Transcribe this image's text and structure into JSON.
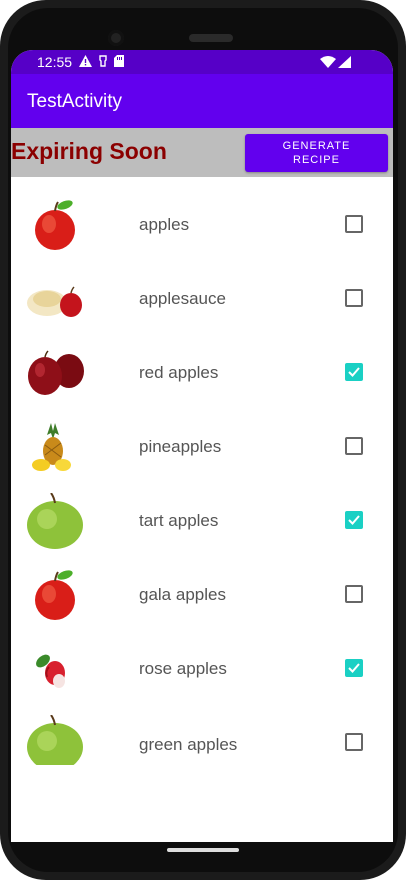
{
  "status_bar": {
    "time": "12:55"
  },
  "app_bar": {
    "title": "TestActivity"
  },
  "header": {
    "title": "Expiring Soon",
    "button_label": "GENERATE RECIPE"
  },
  "items": [
    {
      "label": "apples",
      "checked": false,
      "image": "apple-icon"
    },
    {
      "label": "applesauce",
      "checked": false,
      "image": "applesauce-icon"
    },
    {
      "label": "red apples",
      "checked": true,
      "image": "red-apples-icon"
    },
    {
      "label": "pineapples",
      "checked": false,
      "image": "pineapple-icon"
    },
    {
      "label": "tart apples",
      "checked": true,
      "image": "green-apple-icon"
    },
    {
      "label": "gala apples",
      "checked": false,
      "image": "apple-icon"
    },
    {
      "label": "rose apples",
      "checked": true,
      "image": "rose-apple-icon"
    },
    {
      "label": "green apples",
      "checked": false,
      "image": "green-apple-icon"
    }
  ],
  "colors": {
    "accent": "#6200ee",
    "status": "#5600c7",
    "header_text": "#8b0000",
    "checkbox_on": "#1ad0c4"
  }
}
